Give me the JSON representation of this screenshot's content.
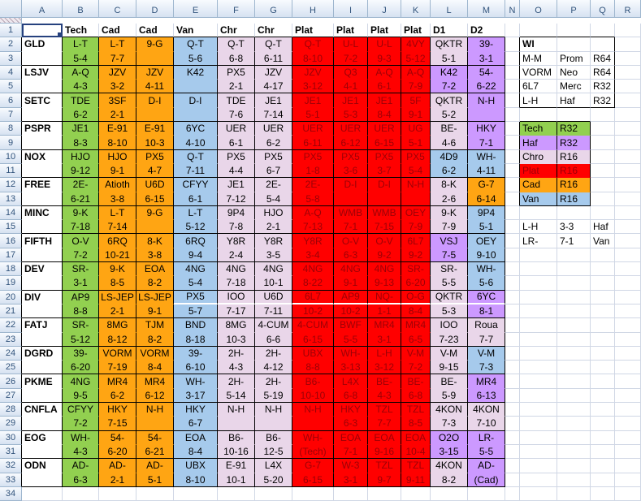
{
  "sheet": {
    "col_letters": [
      "A",
      "B",
      "C",
      "D",
      "E",
      "F",
      "G",
      "H",
      "I",
      "J",
      "K",
      "L",
      "M",
      "N",
      "O",
      "P",
      "Q",
      "R"
    ],
    "row_count": 34
  },
  "colors": {
    "tech": "#92D050",
    "cad": "#FFA513",
    "van": "#A6CAEC",
    "chro": "#E9D6E9",
    "plat": "#FF0000",
    "haf": "#CC99FF",
    "plat_text": "#9C0006"
  },
  "table": {
    "col_headers": [
      {
        "col": "B",
        "label": "Tech"
      },
      {
        "col": "C",
        "label": "Cad"
      },
      {
        "col": "D",
        "label": "Cad"
      },
      {
        "col": "E",
        "label": "Van"
      },
      {
        "col": "F",
        "label": "Chr"
      },
      {
        "col": "G",
        "label": "Chr"
      },
      {
        "col": "H",
        "label": "Plat"
      },
      {
        "col": "I",
        "label": "Plat"
      },
      {
        "col": "J",
        "label": "Plat"
      },
      {
        "col": "K",
        "label": "Plat"
      },
      {
        "col": "L",
        "label": "D1"
      },
      {
        "col": "M",
        "label": "D2"
      }
    ],
    "column_colors": [
      "tech",
      "cad",
      "cad",
      "van",
      "chro",
      "chro",
      "plat",
      "plat",
      "plat",
      "plat",
      null,
      null
    ],
    "teams": [
      {
        "name": "GLD",
        "d1": "chro",
        "d2": "haf",
        "cells": [
          [
            "L-T",
            "5-4"
          ],
          [
            "L-T",
            "7-7"
          ],
          [
            "9-G",
            ""
          ],
          [
            "Q-T",
            "5-6"
          ],
          [
            "Q-T",
            "6-8"
          ],
          [
            "Q-T",
            "6-11"
          ],
          [
            "Q-T",
            "8-10"
          ],
          [
            "U-L",
            "7-2"
          ],
          [
            "U-L",
            "9-3"
          ],
          [
            "4VY",
            "5-12"
          ],
          [
            "QKTR",
            "5-1"
          ],
          [
            "39-",
            "3-1"
          ]
        ]
      },
      {
        "name": "LSJV",
        "d1": "haf",
        "d2": "haf",
        "cells": [
          [
            "A-Q",
            "4-3"
          ],
          [
            "JZV",
            "3-2"
          ],
          [
            "JZV",
            "4-11"
          ],
          [
            "K42",
            ""
          ],
          [
            "PX5",
            "2-1"
          ],
          [
            "JZV",
            "4-17"
          ],
          [
            "JZV",
            "3-12"
          ],
          [
            "Q3",
            "4-1"
          ],
          [
            "A-Q",
            "6-1"
          ],
          [
            "A-Q",
            "7-9"
          ],
          [
            "K42",
            "7-2"
          ],
          [
            "54-",
            "6-22"
          ]
        ]
      },
      {
        "name": "SETC",
        "d1": "chro",
        "d2": "haf",
        "cells": [
          [
            "TDE",
            "6-2"
          ],
          [
            "3SF",
            "2-1"
          ],
          [
            "D-I",
            ""
          ],
          [
            "D-I",
            ""
          ],
          [
            "TDE",
            "7-6"
          ],
          [
            "JE1",
            "7-14"
          ],
          [
            "JE1",
            "5-1"
          ],
          [
            "JE1",
            "5-3"
          ],
          [
            "JE1",
            "8-4"
          ],
          [
            "5F",
            "9-1"
          ],
          [
            "QKTR",
            "5-2"
          ],
          [
            "N-H",
            ""
          ]
        ]
      },
      {
        "name": "PSPR",
        "d1": "chro",
        "d2": "haf",
        "cells": [
          [
            "JE1",
            "8-3"
          ],
          [
            "E-91",
            "8-10"
          ],
          [
            "E-91",
            "10-3"
          ],
          [
            "6YC",
            "4-10"
          ],
          [
            "UER",
            "6-1"
          ],
          [
            "UER",
            "6-2"
          ],
          [
            "UER",
            "6-11"
          ],
          [
            "UER",
            "6-12"
          ],
          [
            "UER",
            "6-15"
          ],
          [
            "UG",
            "5-1"
          ],
          [
            "BE-",
            "4-6"
          ],
          [
            "HKY",
            "7-1"
          ]
        ]
      },
      {
        "name": "NOX",
        "d1": "van",
        "d2": "van",
        "cells": [
          [
            "HJO",
            "9-12"
          ],
          [
            "HJO",
            "9-1"
          ],
          [
            "PX5",
            "4-7"
          ],
          [
            "Q-T",
            "7-11"
          ],
          [
            "PX5",
            "4-4"
          ],
          [
            "PX5",
            "6-7"
          ],
          [
            "PX5",
            "1-8"
          ],
          [
            "PX5",
            "3-6"
          ],
          [
            "PX5",
            "3-7"
          ],
          [
            "PX5",
            "5-4"
          ],
          [
            "4D9",
            "6-2"
          ],
          [
            "WH-",
            "4-11"
          ]
        ]
      },
      {
        "name": "FREE",
        "d1": "chro",
        "d2": "cad",
        "cells": [
          [
            "2E-",
            "6-21"
          ],
          [
            "Atioth",
            "3-8"
          ],
          [
            "U6D",
            "6-15"
          ],
          [
            "CFYY",
            "6-1"
          ],
          [
            "JE1",
            "7-12"
          ],
          [
            "2E-",
            "5-4"
          ],
          [
            "2E-",
            "5-8"
          ],
          [
            "D-I",
            ""
          ],
          [
            "D-I",
            ""
          ],
          [
            "N-H",
            ""
          ],
          [
            "8-K",
            "2-6"
          ],
          [
            "G-7",
            "6-14"
          ]
        ]
      },
      {
        "name": "MINC",
        "d1": "chro",
        "d2": "van",
        "cells": [
          [
            "9-K",
            "7-18"
          ],
          [
            "L-T",
            "7-14"
          ],
          [
            "9-G",
            ""
          ],
          [
            "L-T",
            "5-12"
          ],
          [
            "9P4",
            "7-8"
          ],
          [
            "HJO",
            "2-1"
          ],
          [
            "A-Q",
            "7-13"
          ],
          [
            "WMB",
            "7-1"
          ],
          [
            "WMB",
            "7-15"
          ],
          [
            "OEY",
            "7-9"
          ],
          [
            "9-K",
            "7-9"
          ],
          [
            "9P4",
            "5-1"
          ]
        ]
      },
      {
        "name": "FIFTH",
        "d1": "haf",
        "d2": "van",
        "cells": [
          [
            "O-V",
            "7-2"
          ],
          [
            "6RQ",
            "10-21"
          ],
          [
            "8-K",
            "3-8"
          ],
          [
            "6RQ",
            "9-4"
          ],
          [
            "Y8R",
            "2-4"
          ],
          [
            "Y8R",
            "3-5"
          ],
          [
            "Y8R",
            "3-4"
          ],
          [
            "O-V",
            "6-3"
          ],
          [
            "O-V",
            "9-2"
          ],
          [
            "6L7",
            "9-2"
          ],
          [
            "VSJ",
            "7-5"
          ],
          [
            "OEY",
            "9-10"
          ]
        ]
      },
      {
        "name": "DEV",
        "d1": "chro",
        "d2": "van",
        "cells": [
          [
            "SR-",
            "3-1"
          ],
          [
            "9-K",
            "8-5"
          ],
          [
            "EOA",
            "8-2"
          ],
          [
            "4NG",
            "5-4"
          ],
          [
            "4NG",
            "7-18"
          ],
          [
            "4NG",
            "10-1"
          ],
          [
            "4NG",
            "8-22"
          ],
          [
            "4NG",
            "9-1"
          ],
          [
            "4NG",
            "9-13"
          ],
          [
            "SR-",
            "6-20"
          ],
          [
            "SR-",
            "5-5"
          ],
          [
            "WH-",
            "5-6"
          ]
        ]
      },
      {
        "name": "DIV",
        "d1": "chro",
        "d2": "haf",
        "white_split": true,
        "cells": [
          [
            "AP9",
            "8-8"
          ],
          [
            "LS-JEP",
            "2-1"
          ],
          [
            "LS-JEP",
            "9-1"
          ],
          [
            "PX5",
            "5-7"
          ],
          [
            "IOO",
            "7-17"
          ],
          [
            "U6D",
            "7-11"
          ],
          [
            "6L7",
            "10-2"
          ],
          [
            "AP9",
            "10-2"
          ],
          [
            "NQ-",
            "1-1"
          ],
          [
            "O-G",
            "8-4"
          ],
          [
            "QKTR",
            "5-3"
          ],
          [
            "6YC",
            "8-1"
          ]
        ]
      },
      {
        "name": "FATJ",
        "d1": "chro",
        "d2": "chro",
        "cells": [
          [
            "SR-",
            "5-12"
          ],
          [
            "8MG",
            "8-12"
          ],
          [
            "TJM",
            "8-2"
          ],
          [
            "BND",
            "8-18"
          ],
          [
            "8MG",
            "10-3"
          ],
          [
            "4-CUM",
            "6-6"
          ],
          [
            "4-CUM",
            "6-15"
          ],
          [
            "BWF",
            "5-5"
          ],
          [
            "MR4",
            "3-1"
          ],
          [
            "MR4",
            "6-5"
          ],
          [
            "IOO",
            "7-23"
          ],
          [
            "Roua",
            "7-7"
          ]
        ]
      },
      {
        "name": "DGRD",
        "d1": "chro",
        "d2": "van",
        "cells": [
          [
            "39-",
            "6-20"
          ],
          [
            "VORM",
            "7-19"
          ],
          [
            "VORM",
            "8-4"
          ],
          [
            "39-",
            "6-10"
          ],
          [
            "2H-",
            "4-3"
          ],
          [
            "2H-",
            "4-12"
          ],
          [
            "UBX",
            "8-8"
          ],
          [
            "WH-",
            "3-13"
          ],
          [
            "L-H",
            "3-12"
          ],
          [
            "V-M",
            "7-2"
          ],
          [
            "V-M",
            "9-15"
          ],
          [
            "V-M",
            "7-3"
          ]
        ]
      },
      {
        "name": "PKME",
        "d1": "chro",
        "d2": "haf",
        "cells": [
          [
            "4NG",
            "9-5"
          ],
          [
            "MR4",
            "6-2"
          ],
          [
            "MR4",
            "6-12"
          ],
          [
            "WH-",
            "3-17"
          ],
          [
            "2H-",
            "5-14"
          ],
          [
            "2H-",
            "5-19"
          ],
          [
            "B6-",
            "10-10"
          ],
          [
            "L4X",
            "6-8"
          ],
          [
            "BE-",
            "4-3"
          ],
          [
            "BE-",
            "6-8"
          ],
          [
            "BE-",
            "5-9"
          ],
          [
            "MR4",
            "6-13"
          ]
        ]
      },
      {
        "name": "CNFLA",
        "d1": "chro",
        "d2": "chro",
        "cells": [
          [
            "CFYY",
            "7-2"
          ],
          [
            "HKY",
            "7-15"
          ],
          [
            "N-H",
            ""
          ],
          [
            "HKY",
            "6-7"
          ],
          [
            "N-H",
            ""
          ],
          [
            "N-H",
            ""
          ],
          [
            "N-H",
            ""
          ],
          [
            "HKY",
            "6-3"
          ],
          [
            "TZL",
            "7-7"
          ],
          [
            "TZL",
            "8-5"
          ],
          [
            "4KON",
            "7-3"
          ],
          [
            "4KON",
            "7-10"
          ]
        ]
      },
      {
        "name": "EOG",
        "d1": "haf",
        "d2": "haf",
        "cells": [
          [
            "WH-",
            "4-3"
          ],
          [
            "54-",
            "6-20"
          ],
          [
            "54-",
            "6-21"
          ],
          [
            "EOA",
            "8-4"
          ],
          [
            "B6-",
            "10-16"
          ],
          [
            "B6-",
            "12-5"
          ],
          [
            "WH-",
            "(Tech)"
          ],
          [
            "EOA",
            "7-1"
          ],
          [
            "EOA",
            "9-16"
          ],
          [
            "EOA",
            "10-4"
          ],
          [
            "O2O",
            "3-15"
          ],
          [
            "LR-",
            "5-5"
          ]
        ]
      },
      {
        "name": "ODN",
        "d1": "chro",
        "d2": "haf",
        "cells": [
          [
            "AD-",
            "6-3"
          ],
          [
            "AD-",
            "2-1"
          ],
          [
            "AD-",
            "5-1"
          ],
          [
            "UBX",
            "8-10"
          ],
          [
            "E-91",
            "10-1"
          ],
          [
            "L4X",
            "5-20"
          ],
          [
            "G-7",
            "6-15"
          ],
          [
            "W-3",
            "3-1"
          ],
          [
            "TZL",
            "9-7"
          ],
          [
            "TZL",
            "9-11"
          ],
          [
            "4KON",
            "8-2"
          ],
          [
            "AD-",
            "(Cad)"
          ]
        ]
      }
    ]
  },
  "side": {
    "wi": {
      "title": "WI",
      "rows": [
        [
          "M-M",
          "Prom",
          "R64"
        ],
        [
          "VORM",
          "Neo",
          "R64"
        ],
        [
          "6L7",
          "Merc",
          "R32"
        ],
        [
          "L-H",
          "Haf",
          "R32"
        ]
      ]
    },
    "legend": [
      {
        "label": "Tech",
        "round": "R32",
        "color": "tech"
      },
      {
        "label": "Haf",
        "round": "R32",
        "color": "haf"
      },
      {
        "label": "Chro",
        "round": "R16",
        "color": "chro"
      },
      {
        "label": "Plat",
        "round": "R16",
        "color": "plat"
      },
      {
        "label": "Cad",
        "round": "R16",
        "color": "cad"
      },
      {
        "label": "Van",
        "round": "R16",
        "color": "van"
      }
    ],
    "notes": [
      [
        "L-H",
        "3-3",
        "Haf"
      ],
      [
        "LR-",
        "7-1",
        "Van"
      ]
    ]
  }
}
